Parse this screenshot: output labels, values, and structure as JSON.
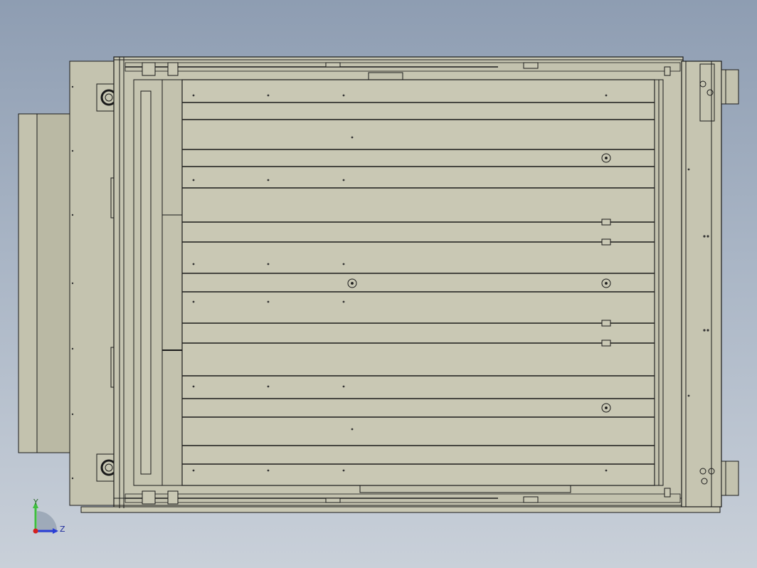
{
  "viewport": {
    "background_top": "#8e9db2",
    "background_bottom": "#c9d0d9"
  },
  "model": {
    "body_color": "#c9c8b4",
    "panel_color": "#c1c0ac",
    "edge_color": "#1a1a1a",
    "shadow_color": "#b3b29d"
  },
  "triad": {
    "y_label": "Y",
    "z_label": "Z",
    "y_color": "#3fbf3f",
    "z_color": "#2b3fd6",
    "x_color": "#d42020"
  }
}
